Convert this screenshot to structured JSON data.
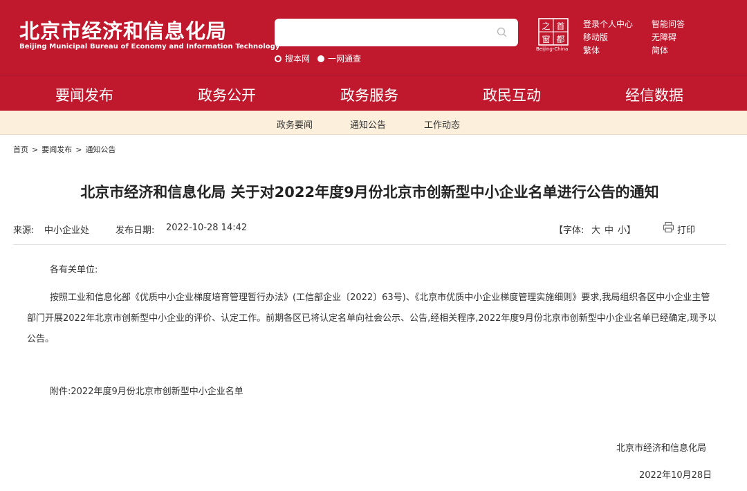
{
  "header": {
    "org_name_cn": "北京市经济和信息化局",
    "org_name_en": "Beijing Municipal Bureau of Economy and Information Technology",
    "search": {
      "value": "",
      "option_site": "搜本网",
      "option_all": "一网通查"
    },
    "capital_window": {
      "caption": "Beijing-China",
      "glyphs": [
        "之",
        "首",
        "窗",
        "都"
      ]
    },
    "links": {
      "login": "登录个人中心",
      "qa": "智能问答",
      "mobile": "移动版",
      "accessible": "无障碍",
      "traditional": "繁体",
      "simplified": "简体"
    },
    "colors": {
      "brand_red": "#c0182d",
      "subnav_bg": "#fcf0dc"
    }
  },
  "nav": {
    "items": [
      "要闻发布",
      "政务公开",
      "政务服务",
      "政民互动",
      "经信数据"
    ],
    "active": "要闻发布"
  },
  "subnav": {
    "items": [
      "政务要闻",
      "通知公告",
      "工作动态"
    ]
  },
  "breadcrumb": [
    "首页",
    "要闻发布",
    "通知公告"
  ],
  "breadcrumb_sep": ">",
  "article": {
    "title": "北京市经济和信息化局 关于对2022年度9月份北京市创新型中小企业名单进行公告的通知",
    "source_label": "来源:",
    "source": "中小企业处",
    "date_label": "发布日期:",
    "date": "2022-10-28 14:42",
    "font_size_label": "【字体:",
    "font_large": "大",
    "font_medium": "中",
    "font_small": "小】",
    "print": "打印",
    "salutation": "各有关单位:",
    "body": "按照工业和信息化部《优质中小企业梯度培育管理暂行办法》(工信部企业〔2022〕63号)、《北京市优质中小企业梯度管理实施细则》要求,我局组织各区中小企业主管部门开展2022年北京市创新型中小企业的评价、认定工作。前期各区已将认定名单向社会公示、公告,经相关程序,2022年度9月份北京市创新型中小企业名单已经确定,现予以公告。",
    "attachment": "附件:2022年度9月份北京市创新型中小企业名单",
    "signature": "北京市经济和信息化局",
    "sign_date": "2022年10月28日"
  }
}
